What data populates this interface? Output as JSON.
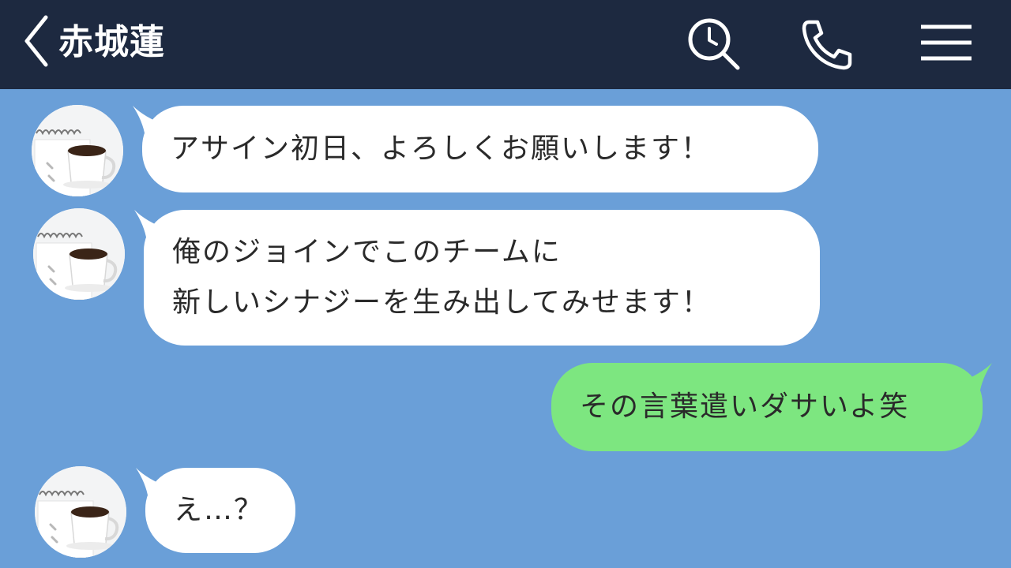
{
  "header": {
    "title": "赤城蓮",
    "back_icon": "chevron-left-icon",
    "search_icon": "search-clock-icon",
    "call_icon": "phone-icon",
    "menu_icon": "hamburger-menu-icon",
    "background_color": "#1d2940"
  },
  "chat": {
    "background_color": "#6a9fd8",
    "incoming_bubble_color": "#ffffff",
    "outgoing_bubble_color": "#7de680",
    "avatar_icon": "coffee-cup-avatar",
    "messages": [
      {
        "direction": "incoming",
        "lines": [
          "アサイン初日、よろしくお願いします！"
        ]
      },
      {
        "direction": "incoming",
        "lines": [
          "俺のジョインでこのチームに",
          "新しいシナジーを生み出してみせます！"
        ]
      },
      {
        "direction": "outgoing",
        "lines": [
          "その言葉遣いダサいよ笑"
        ]
      },
      {
        "direction": "incoming",
        "lines": [
          "え…？"
        ]
      }
    ]
  }
}
